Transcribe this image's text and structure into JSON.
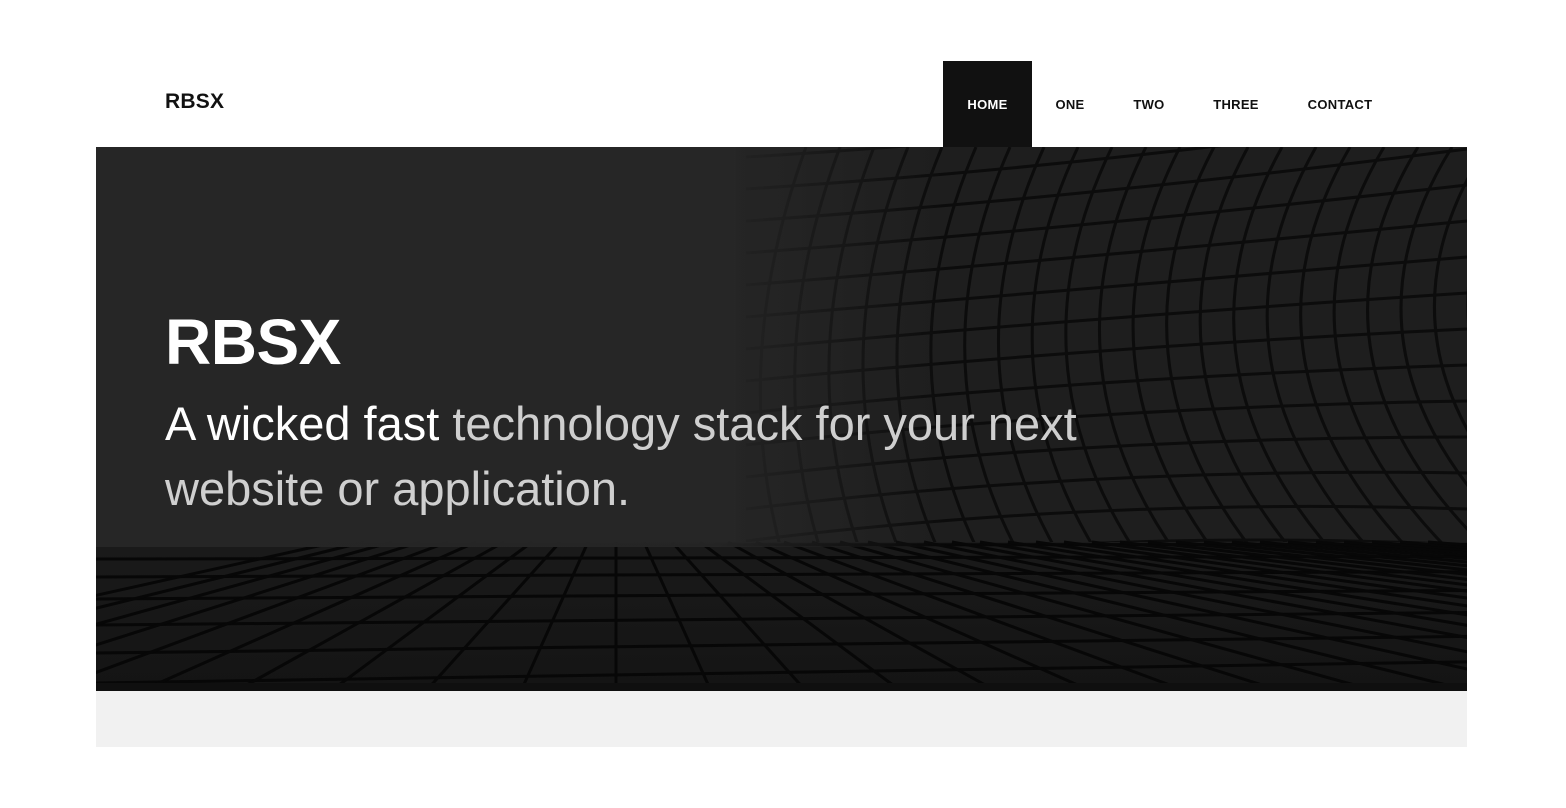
{
  "header": {
    "logo": "RBSX",
    "nav": [
      {
        "label": "HOME",
        "active": true
      },
      {
        "label": "ONE",
        "active": false
      },
      {
        "label": "TWO",
        "active": false
      },
      {
        "label": "THREE",
        "active": false
      },
      {
        "label": "CONTACT",
        "active": false
      }
    ]
  },
  "hero": {
    "title": "RBSX",
    "subtitle_part1": "A wicked fast ",
    "subtitle_part2": "technology stack for your next website or application.",
    "background_image": "architectural-grid-building-photo"
  },
  "colors": {
    "nav_active_bg": "#111111",
    "hero_bg": "#242424",
    "below_bg": "#f1f1f1"
  }
}
